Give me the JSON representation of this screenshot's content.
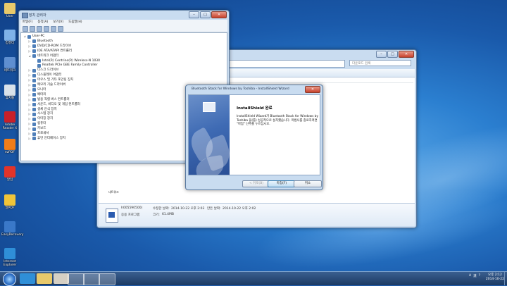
{
  "desktop_icons": [
    {
      "label": "User",
      "color": "#e8c96b"
    },
    {
      "label": "컴퓨터",
      "color": "#7fb2e8"
    },
    {
      "label": "네트워크",
      "color": "#5f8fd0"
    },
    {
      "label": "휴지통",
      "color": "#d9e2ea"
    },
    {
      "label": "Adobe Reader X",
      "color": "#c8202a"
    },
    {
      "label": "ezPDF",
      "color": "#f07d1a"
    },
    {
      "label": "알집",
      "color": "#e2342a"
    },
    {
      "label": "알PDF",
      "color": "#f0c53a"
    },
    {
      "label": "EasyRecovery",
      "color": "#3a78c8"
    },
    {
      "label": "Internet Explorer",
      "color": "#2f8fd8"
    }
  ],
  "explorer": {
    "search_placeholder": "다운로드 검색",
    "file_line": "네트워크",
    "details": {
      "name": "h005590500(",
      "modified_label": "수정한 날짜:",
      "modified_value": "2014-10-22 오후 2:03",
      "created_label": "만든 날짜:",
      "created_value": "2014-10-22 오후 2:02",
      "type_label": "응용 프로그램",
      "size_label": "크기:",
      "size_value": "61.4MB"
    }
  },
  "devmgr": {
    "title": "장치 관리자",
    "menu": [
      "파일(F)",
      "동작(A)",
      "보기(V)",
      "도움말(H)"
    ],
    "tree": [
      {
        "exp": "⊿",
        "label": "User-PC",
        "depth": 0
      },
      {
        "exp": "▷",
        "label": "Bluetooth",
        "depth": 1
      },
      {
        "exp": "▷",
        "label": "DVD/CD-ROM 드라이브",
        "depth": 1
      },
      {
        "exp": "▷",
        "label": "IDE ATA/ATAPI 컨트롤러",
        "depth": 1
      },
      {
        "exp": "⊿",
        "label": "네트워크 어댑터",
        "depth": 1
      },
      {
        "exp": "",
        "label": "Intel(R) Centrino(R) Wireless-N 1030",
        "depth": 2
      },
      {
        "exp": "",
        "label": "Realtek PCIe GBE Family Controller",
        "depth": 2
      },
      {
        "exp": "▷",
        "label": "디스크 드라이브",
        "depth": 1
      },
      {
        "exp": "▷",
        "label": "디스플레이 어댑터",
        "depth": 1
      },
      {
        "exp": "▷",
        "label": "마우스 및 기타 포인팅 장치",
        "depth": 1
      },
      {
        "exp": "▷",
        "label": "메모리 기술 드라이버",
        "depth": 1
      },
      {
        "exp": "▷",
        "label": "모니터",
        "depth": 1
      },
      {
        "exp": "▷",
        "label": "배터리",
        "depth": 1
      },
      {
        "exp": "▷",
        "label": "범용 직렬 버스 컨트롤러",
        "depth": 1
      },
      {
        "exp": "▷",
        "label": "사운드, 비디오 및 게임 컨트롤러",
        "depth": 1
      },
      {
        "exp": "▷",
        "label": "생체 인식 장치",
        "depth": 1
      },
      {
        "exp": "▷",
        "label": "시스템 장치",
        "depth": 1
      },
      {
        "exp": "▷",
        "label": "이미징 장치",
        "depth": 1
      },
      {
        "exp": "▷",
        "label": "컴퓨터",
        "depth": 1
      },
      {
        "exp": "▷",
        "label": "키보드",
        "depth": 1
      },
      {
        "exp": "▷",
        "label": "프로세서",
        "depth": 1
      },
      {
        "exp": "▷",
        "label": "휴먼 인터페이스 장치",
        "depth": 1
      }
    ]
  },
  "wizard": {
    "title": "Bluetooth Stack for Windows by Toshiba - InstallShield Wizard",
    "heading": "InstallShield 완료",
    "body": "InstallShield Wizard가 Bluetooth Stack for Windows by Toshiba 을(를) 성공적으로 설치했습니다. 마법사를 종료하려면 \"마침\" 단추를 누르십시오.",
    "back": "< 뒤로(B)",
    "finish": "마침(F)",
    "cancel": "취소"
  },
  "taskbar": {
    "tray": [
      "A",
      "漢",
      "?"
    ],
    "time": "오후 2:12",
    "date": "2014-10-22"
  }
}
